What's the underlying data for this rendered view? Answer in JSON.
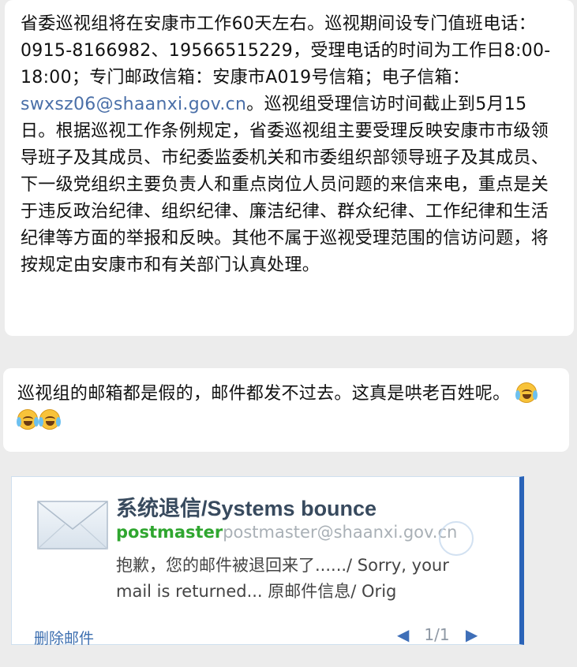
{
  "message1": {
    "text_before_email": "省委巡视组将在安康市工作60天左右。巡视期间设专门值班电话：0915-8166982、19566515229，受理电话的时间为工作日8:00-18:00；专门邮政信箱：安康市A019号信箱；电子信箱：",
    "email": "swxsz06@shaanxi.gov.cn",
    "text_after_email": "。巡视组受理信访时间截止到5月15日。根据巡视工作条例规定，省委巡视组主要受理反映安康市市级领导班子及其成员、市纪委监委机关和市委组织部领导班子及其成员、下一级党组织主要负责人和重点岗位人员问题的来信来电，重点是关于违反政治纪律、组织纪律、廉洁纪律、群众纪律、工作纪律和生活纪律等方面的举报和反映。其他不属于巡视受理范围的信访问题，将按规定由安康市和有关部门认真处理。"
  },
  "message2": {
    "text": "巡视组的邮箱都是假的，邮件都发不过去。这真是哄老百姓呢。",
    "emoji": [
      "crying-laughing",
      "crying-laughing",
      "crying-laughing"
    ]
  },
  "mail_card": {
    "title": "系统退信/Systems bounce",
    "sender_name": "postmaster",
    "sender_address": "postmaster@shaanxi.gov.cn",
    "snippet_line1": "抱歉，您的邮件被退回来了....../ Sorry, your",
    "snippet_line2": "mail is returned...    原邮件信息/ Orig",
    "delete_label": "删除邮件",
    "pager": "1/1",
    "icon": "envelope-icon",
    "accent": "#2a63b8"
  }
}
